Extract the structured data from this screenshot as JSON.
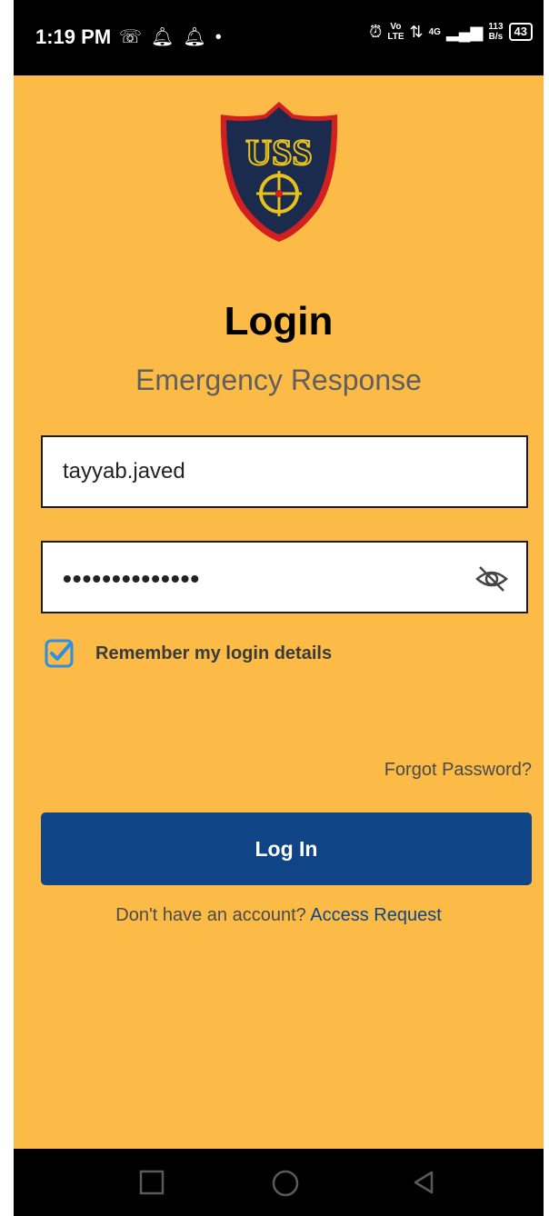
{
  "status_bar": {
    "time": "1:19 PM",
    "left_icons": [
      "whatsapp-icon",
      "notification-bell-icon",
      "notification-bell-icon",
      "dot-icon"
    ],
    "volte_top": "Vo",
    "volte_bottom": "LTE",
    "network_type": "4G",
    "speed_value": "113",
    "speed_unit": "B/s",
    "battery": "43"
  },
  "logo": {
    "text": "USS",
    "colors": {
      "shield": "#1b2b4e",
      "border": "#d21f1f",
      "accent": "#e7c21c"
    }
  },
  "header": {
    "title": "Login",
    "subtitle": "Emergency Response"
  },
  "form": {
    "username_value": "tayyab.javed",
    "password_mask": "••••••••••••••",
    "remember_label": "Remember my login details",
    "remember_checked": true,
    "forgot_label": "Forgot Password?",
    "login_button": "Log In",
    "signup_prompt": "Don't have an account? ",
    "signup_link": "Access Request"
  },
  "colors": {
    "background": "#fbbb46",
    "primary_button": "#0f4486",
    "checkbox": "#2d8fe3"
  },
  "nav_bar": {
    "buttons": [
      "recent-apps-icon",
      "home-icon",
      "back-icon"
    ]
  }
}
